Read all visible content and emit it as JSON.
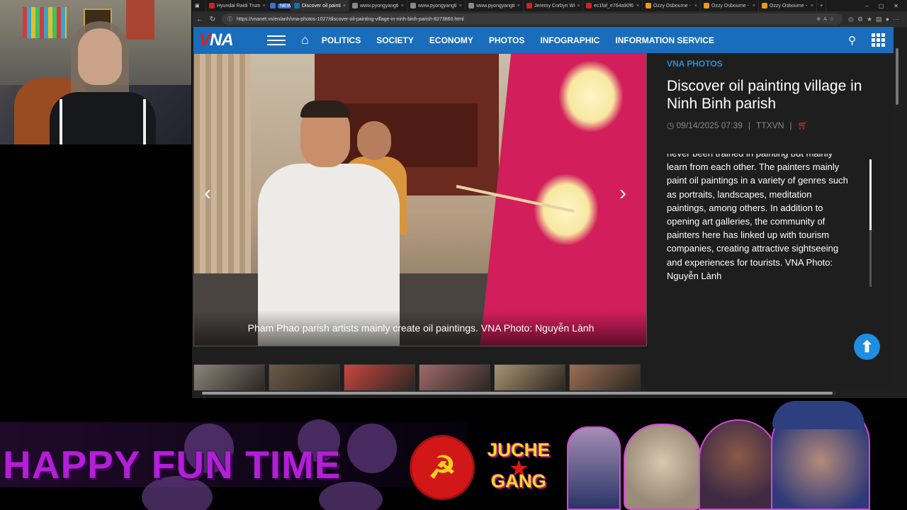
{
  "browser": {
    "tabs": [
      {
        "label": "Hyundai Raidi Trum",
        "color": "#d42020"
      },
      {
        "label": "NEWS",
        "color": "#3b6fd6",
        "badge": true
      },
      {
        "label": "Discover oil painti",
        "color": "#1a6dba",
        "active": true
      },
      {
        "label": "www.pyongyangti",
        "color": "#888888"
      },
      {
        "label": "www.pyongyangti",
        "color": "#888888"
      },
      {
        "label": "www.pyongyangti",
        "color": "#888888"
      },
      {
        "label": "Jeremy Corbyn Wi",
        "color": "#d42020"
      },
      {
        "label": "ec1faf_e764a90f6",
        "color": "#d42020"
      },
      {
        "label": "Ozzy Osbourne -",
        "color": "#e89a1e"
      },
      {
        "label": "Ozzy Osbourne -",
        "color": "#e89a1e"
      },
      {
        "label": "Ozzy Osbourne -",
        "color": "#e89a1e"
      }
    ],
    "url": "https://vnanet.vn/en/anh/vna-photos-1027/discover-oil-painting-village-in-ninh-binh-parish-8273860.html"
  },
  "site": {
    "logo": "VNA",
    "menu": [
      "POLITICS",
      "SOCIETY",
      "ECONOMY",
      "PHOTOS",
      "INFOGRAPHIC",
      "INFORMATION SERVICE"
    ]
  },
  "photo": {
    "caption": "Pham Phao parish artists mainly create oil paintings. VNA Photo: Nguyễn Lành"
  },
  "article": {
    "category": "VNA PHOTOS",
    "title": "Discover oil painting village in Ninh Binh parish",
    "datetime": "09/14/2025 07:39",
    "source": "TTXVN",
    "body": "never been trained in painting but mainly learn from each other. The painters mainly paint oil paintings in a variety of genres such as portraits, landscapes, meditation paintings, among others. In addition to opening art galleries, the community of painters here has linked up with tourism companies, creating attractive sightseeing and experiences for tourists. VNA Photo: Nguyễn Lành"
  },
  "thumbnails": [
    {
      "color": "#8d857a"
    },
    {
      "color": "#6b5a47"
    },
    {
      "color": "#c9463f"
    },
    {
      "color": "#a06a6a"
    },
    {
      "color": "#a89370"
    },
    {
      "color": "#9b6f55"
    }
  ],
  "overlay": {
    "headline": "HAPPY FUN TIME",
    "badge_line1": "JUCHE",
    "badge_line2": "GANG"
  },
  "colors": {
    "nav_blue": "#1a6dba",
    "accent_red": "#e31d1d",
    "headline_purple": "#b21fd6"
  }
}
